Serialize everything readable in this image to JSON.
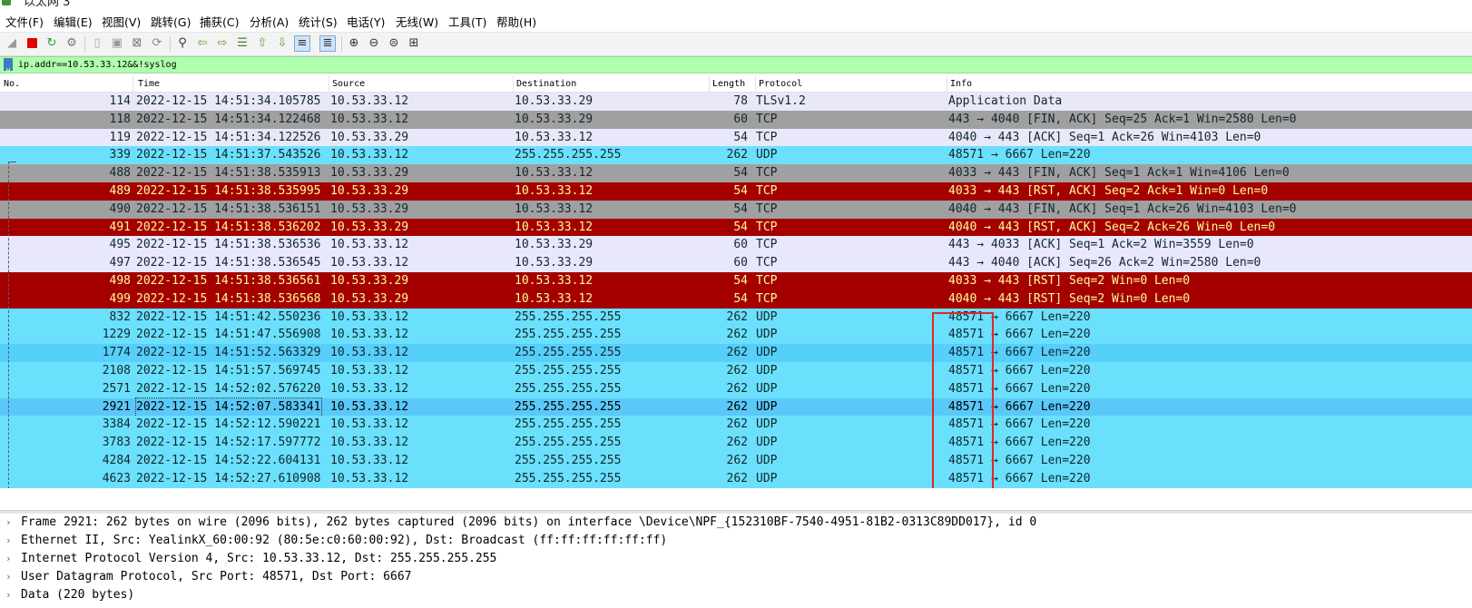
{
  "window": {
    "title": "以太网 3"
  },
  "menu": [
    "文件(F)",
    "编辑(E)",
    "视图(V)",
    "跳转(G)",
    "捕获(C)",
    "分析(A)",
    "统计(S)",
    "电话(Y)",
    "无线(W)",
    "工具(T)",
    "帮助(H)"
  ],
  "toolbar": {
    "icons": [
      "shark-fin-start-icon",
      "stop-capture-icon",
      "restart-capture-icon",
      "capture-options-icon",
      "open-file-icon",
      "save-file-icon",
      "close-file-icon",
      "reload-file-icon",
      "find-packet-icon",
      "go-back-icon",
      "go-forward-icon",
      "go-to-packet-icon",
      "go-first-icon",
      "go-last-icon",
      "autoscroll-icon",
      "colorize-icon",
      "zoom-in-icon",
      "zoom-out-icon",
      "zoom-normal-icon",
      "resize-columns-icon"
    ]
  },
  "filter": {
    "value": "ip.addr==10.53.33.12&&!syslog"
  },
  "columns": {
    "no": "No.",
    "time": "Time",
    "source": "Source",
    "destination": "Destination",
    "length": "Length",
    "protocol": "Protocol",
    "info": "Info"
  },
  "packets": [
    {
      "no": "114",
      "time": "2022-12-15 14:51:34.105785",
      "src": "10.53.33.12",
      "dst": "10.53.33.29",
      "len": "78",
      "proto": "TLSv1.2",
      "info": "Application Data",
      "color": "white"
    },
    {
      "no": "118",
      "time": "2022-12-15 14:51:34.122468",
      "src": "10.53.33.12",
      "dst": "10.53.33.29",
      "len": "60",
      "proto": "TCP",
      "info": "443 → 4040 [FIN, ACK] Seq=25 Ack=1 Win=2580 Len=0",
      "color": "gray"
    },
    {
      "no": "119",
      "time": "2022-12-15 14:51:34.122526",
      "src": "10.53.33.29",
      "dst": "10.53.33.12",
      "len": "54",
      "proto": "TCP",
      "info": "4040 → 443 [ACK] Seq=1 Ack=26 Win=4103 Len=0",
      "color": "white"
    },
    {
      "no": "339",
      "time": "2022-12-15 14:51:37.543526",
      "src": "10.53.33.12",
      "dst": "255.255.255.255",
      "len": "262",
      "proto": "UDP",
      "info": "48571 → 6667 Len=220",
      "color": "cyan"
    },
    {
      "no": "488",
      "time": "2022-12-15 14:51:38.535913",
      "src": "10.53.33.29",
      "dst": "10.53.33.12",
      "len": "54",
      "proto": "TCP",
      "info": "4033 → 443 [FIN, ACK] Seq=1 Ack=1 Win=4106 Len=0",
      "color": "gray"
    },
    {
      "no": "489",
      "time": "2022-12-15 14:51:38.535995",
      "src": "10.53.33.29",
      "dst": "10.53.33.12",
      "len": "54",
      "proto": "TCP",
      "info": "4033 → 443 [RST, ACK] Seq=2 Ack=1 Win=0 Len=0",
      "color": "red"
    },
    {
      "no": "490",
      "time": "2022-12-15 14:51:38.536151",
      "src": "10.53.33.29",
      "dst": "10.53.33.12",
      "len": "54",
      "proto": "TCP",
      "info": "4040 → 443 [FIN, ACK] Seq=1 Ack=26 Win=4103 Len=0",
      "color": "gray"
    },
    {
      "no": "491",
      "time": "2022-12-15 14:51:38.536202",
      "src": "10.53.33.29",
      "dst": "10.53.33.12",
      "len": "54",
      "proto": "TCP",
      "info": "4040 → 443 [RST, ACK] Seq=2 Ack=26 Win=0 Len=0",
      "color": "red"
    },
    {
      "no": "495",
      "time": "2022-12-15 14:51:38.536536",
      "src": "10.53.33.12",
      "dst": "10.53.33.29",
      "len": "60",
      "proto": "TCP",
      "info": "443 → 4033 [ACK] Seq=1 Ack=2 Win=3559 Len=0",
      "color": "white"
    },
    {
      "no": "497",
      "time": "2022-12-15 14:51:38.536545",
      "src": "10.53.33.12",
      "dst": "10.53.33.29",
      "len": "60",
      "proto": "TCP",
      "info": "443 → 4040 [ACK] Seq=26 Ack=2 Win=2580 Len=0",
      "color": "white"
    },
    {
      "no": "498",
      "time": "2022-12-15 14:51:38.536561",
      "src": "10.53.33.29",
      "dst": "10.53.33.12",
      "len": "54",
      "proto": "TCP",
      "info": "4033 → 443 [RST] Seq=2 Win=0 Len=0",
      "color": "red"
    },
    {
      "no": "499",
      "time": "2022-12-15 14:51:38.536568",
      "src": "10.53.33.29",
      "dst": "10.53.33.12",
      "len": "54",
      "proto": "TCP",
      "info": "4040 → 443 [RST] Seq=2 Win=0 Len=0",
      "color": "red"
    },
    {
      "no": "832",
      "time": "2022-12-15 14:51:42.550236",
      "src": "10.53.33.12",
      "dst": "255.255.255.255",
      "len": "262",
      "proto": "UDP",
      "info": "48571 → 6667 Len=220",
      "color": "cyan"
    },
    {
      "no": "1229",
      "time": "2022-12-15 14:51:47.556908",
      "src": "10.53.33.12",
      "dst": "255.255.255.255",
      "len": "262",
      "proto": "UDP",
      "info": "48571 → 6667 Len=220",
      "color": "cyan"
    },
    {
      "no": "1774",
      "time": "2022-12-15 14:51:52.563329",
      "src": "10.53.33.12",
      "dst": "255.255.255.255",
      "len": "262",
      "proto": "UDP",
      "info": "48571 → 6667 Len=220",
      "color": "cyan2"
    },
    {
      "no": "2108",
      "time": "2022-12-15 14:51:57.569745",
      "src": "10.53.33.12",
      "dst": "255.255.255.255",
      "len": "262",
      "proto": "UDP",
      "info": "48571 → 6667 Len=220",
      "color": "cyan"
    },
    {
      "no": "2571",
      "time": "2022-12-15 14:52:02.576220",
      "src": "10.53.33.12",
      "dst": "255.255.255.255",
      "len": "262",
      "proto": "UDP",
      "info": "48571 → 6667 Len=220",
      "color": "cyan"
    },
    {
      "no": "2921",
      "time": "2022-12-15 14:52:07.583341",
      "src": "10.53.33.12",
      "dst": "255.255.255.255",
      "len": "262",
      "proto": "UDP",
      "info": "48571 → 6667 Len=220",
      "color": "selected"
    },
    {
      "no": "3384",
      "time": "2022-12-15 14:52:12.590221",
      "src": "10.53.33.12",
      "dst": "255.255.255.255",
      "len": "262",
      "proto": "UDP",
      "info": "48571 → 6667 Len=220",
      "color": "cyan"
    },
    {
      "no": "3783",
      "time": "2022-12-15 14:52:17.597772",
      "src": "10.53.33.12",
      "dst": "255.255.255.255",
      "len": "262",
      "proto": "UDP",
      "info": "48571 → 6667 Len=220",
      "color": "cyan"
    },
    {
      "no": "4284",
      "time": "2022-12-15 14:52:22.604131",
      "src": "10.53.33.12",
      "dst": "255.255.255.255",
      "len": "262",
      "proto": "UDP",
      "info": "48571 → 6667 Len=220",
      "color": "cyan"
    },
    {
      "no": "4623",
      "time": "2022-12-15 14:52:27.610908",
      "src": "10.53.33.12",
      "dst": "255.255.255.255",
      "len": "262",
      "proto": "UDP",
      "info": "48571 → 6667 Len=220",
      "color": "cyan"
    }
  ],
  "details": [
    "Frame 2921: 262 bytes on wire (2096 bits), 262 bytes captured (2096 bits) on interface \\Device\\NPF_{152310BF-7540-4951-81B2-0313C89DD017}, id 0",
    "Ethernet II, Src: YealinkX_60:00:92 (80:5e:c0:60:00:92), Dst: Broadcast (ff:ff:ff:ff:ff:ff)",
    "Internet Protocol Version 4, Src: 10.53.33.12, Dst: 255.255.255.255",
    "User Datagram Protocol, Src Port: 48571, Dst Port: 6667",
    "Data (220 bytes)"
  ],
  "colors": {
    "white": "#e8e8fa",
    "gray": "#a0a0a0",
    "red": "#a40000",
    "red_text": "#fffc9c",
    "cyan": "#6be0fc",
    "filter_bg": "#afffaf",
    "highlight_box": "#e02828"
  }
}
